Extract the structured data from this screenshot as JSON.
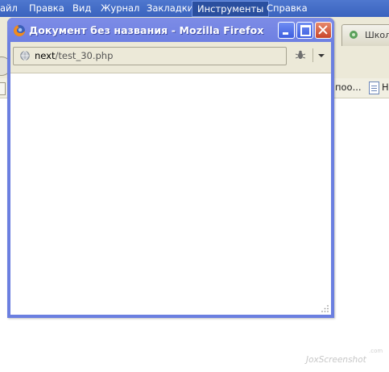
{
  "background_window": {
    "menu": [
      "айл",
      "Правка",
      "Вид",
      "Журнал",
      "Закладки",
      "Инструменты",
      "Справка"
    ],
    "active_menu_index": 5,
    "tab_label": "Школ",
    "bookmark_text": "поо...",
    "bookmark_tail": "Н"
  },
  "popup": {
    "title": "Документ без названия - Mozilla Firefox",
    "url_host": "next",
    "url_path": "/test_30.php",
    "icons": {
      "title": "firefox-icon",
      "url": "globe-icon",
      "addon": "bug-icon"
    }
  },
  "watermark": {
    "text": "JoxScreenshot",
    "dot": ".com"
  },
  "colors": {
    "titlebar": "#6e80e2",
    "window_border": "#0a36c9",
    "menubar": "#4f78cf",
    "chrome": "#ece9d8",
    "close_button": "#c8452a"
  }
}
